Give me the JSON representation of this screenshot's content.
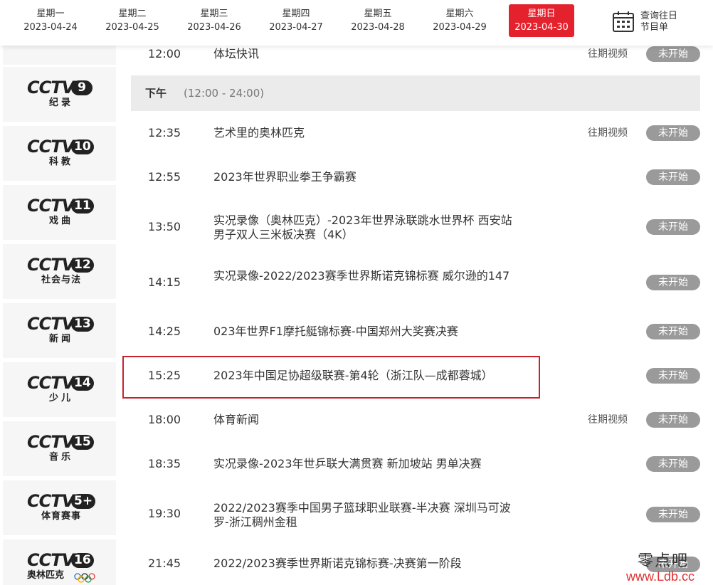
{
  "days": [
    {
      "weekday": "星期一",
      "date": "2023-04-24",
      "active": false
    },
    {
      "weekday": "星期二",
      "date": "2023-04-25",
      "active": false
    },
    {
      "weekday": "星期三",
      "date": "2023-04-26",
      "active": false
    },
    {
      "weekday": "星期四",
      "date": "2023-04-27",
      "active": false
    },
    {
      "weekday": "星期五",
      "date": "2023-04-28",
      "active": false
    },
    {
      "weekday": "星期六",
      "date": "2023-04-29",
      "active": false
    },
    {
      "weekday": "星期日",
      "date": "2023-04-30",
      "active": true
    }
  ],
  "history_button": {
    "line1": "查询往日",
    "line2": "节目单",
    "icon": "calendar-icon"
  },
  "channels": [
    {
      "brand": "CCTV",
      "number": "9",
      "name": "纪录"
    },
    {
      "brand": "CCTV",
      "number": "10",
      "name": "科教"
    },
    {
      "brand": "CCTV",
      "number": "11",
      "name": "戏曲"
    },
    {
      "brand": "CCTV",
      "number": "12",
      "name": "社会与法"
    },
    {
      "brand": "CCTV",
      "number": "13",
      "name": "新闻"
    },
    {
      "brand": "CCTV",
      "number": "14",
      "name": "少儿"
    },
    {
      "brand": "CCTV",
      "number": "15",
      "name": "音乐"
    },
    {
      "brand": "CCTV",
      "number": "5+",
      "name": "体育赛事"
    },
    {
      "brand": "CCTV",
      "number": "16",
      "name": "奥林匹克"
    }
  ],
  "period": {
    "name": "下午",
    "range": "(12:00 - 24:00)"
  },
  "top_partial": {
    "time": "12:00",
    "title": "体坛快讯",
    "replay": "往期视频",
    "status": "未开始"
  },
  "programs": [
    {
      "time": "12:35",
      "title": "艺术里的奥林匹克",
      "replay": "往期视频",
      "status": "未开始"
    },
    {
      "time": "12:55",
      "title": "2023年世界职业拳王争霸赛",
      "replay": "",
      "status": "未开始"
    },
    {
      "time": "13:50",
      "title": "实况录像（奥林匹克）-2023年世界泳联跳水世界杯 西安站 男子双人三米板决赛（4K）",
      "replay": "",
      "status": "未开始"
    },
    {
      "time": "14:15",
      "title": "实况录像-2022/2023赛季世界斯诺克锦标赛 威尔逊的147",
      "replay": "",
      "status": "未开始"
    },
    {
      "time": "14:25",
      "title": "023年世界F1摩托艇锦标赛-中国郑州大奖赛决赛",
      "replay": "",
      "status": "未开始"
    },
    {
      "time": "15:25",
      "title": "2023年中国足协超级联赛-第4轮（浙江队—成都蓉城）",
      "replay": "",
      "status": "未开始"
    },
    {
      "time": "18:00",
      "title": "体育新闻",
      "replay": "往期视频",
      "status": "未开始"
    },
    {
      "time": "18:35",
      "title": "实况录像-2023年世乒联大满贯赛 新加坡站 男单决赛",
      "replay": "",
      "status": "未开始"
    },
    {
      "time": "19:30",
      "title": "2022/2023赛季中国男子篮球职业联赛-半决赛 深圳马可波罗-浙江稠州金租",
      "replay": "",
      "status": "未开始"
    },
    {
      "time": "21:45",
      "title": "2022/2023赛季世界斯诺克锦标赛-决赛第一阶段",
      "replay": "",
      "status": "未开始"
    }
  ],
  "watermark": {
    "line1": "零点吧",
    "line2": "www.Ldb.cc"
  },
  "colors": {
    "accent": "#e4222e",
    "status_bg": "#9a9a9a",
    "highlight": "#c8232c"
  }
}
